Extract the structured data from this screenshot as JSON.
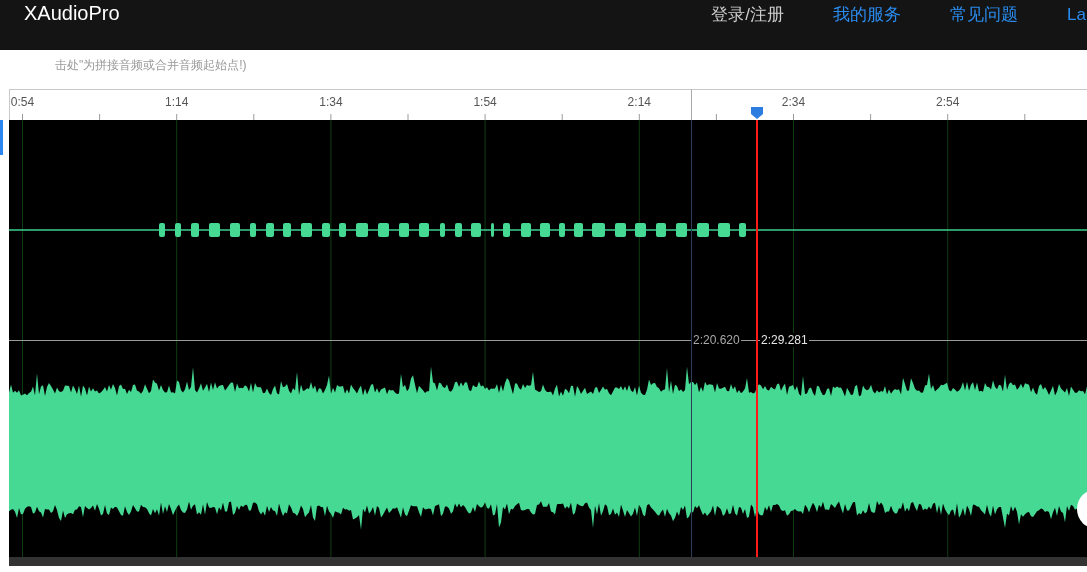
{
  "header": {
    "logo": "XAudioPro",
    "nav": [
      {
        "label": "登录/注册",
        "kind": "account"
      },
      {
        "label": "我的服务",
        "kind": "link"
      },
      {
        "label": "常见问题",
        "kind": "link"
      },
      {
        "label": "La",
        "kind": "link"
      }
    ]
  },
  "hint": "击处\"为拼接音频或合并音频起始点!)",
  "ruler": {
    "labels": [
      "0:54",
      "1:14",
      "1:34",
      "1:54",
      "2:14",
      "2:34",
      "2:54"
    ]
  },
  "markers": [
    {
      "kind": "selection",
      "label": "2:20.620"
    },
    {
      "kind": "playhead",
      "label": "2:29.281"
    }
  ]
}
